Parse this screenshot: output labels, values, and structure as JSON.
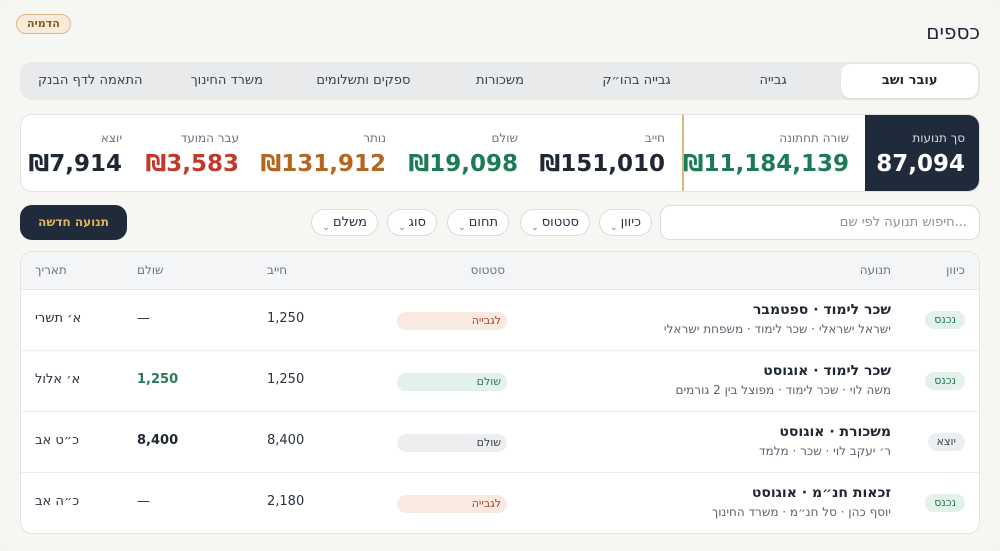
{
  "demo_badge": "הדמיה",
  "page_title": "כספים",
  "tabs": [
    {
      "label": "עובר ושב",
      "active": true
    },
    {
      "label": "גבייה",
      "active": false
    },
    {
      "label": "גבייה בהו״ק",
      "active": false
    },
    {
      "label": "משכורות",
      "active": false
    },
    {
      "label": "ספקים ותשלומים",
      "active": false
    },
    {
      "label": "משרד החינוך",
      "active": false
    },
    {
      "label": "התאמה לדף הבנק",
      "active": false
    }
  ],
  "stats": {
    "total": {
      "label": "סך תנועות",
      "value": "87,094"
    },
    "bottom_line": {
      "label": "שורה תחתונה",
      "value": "₪11,184,139",
      "color": "#1c7a55"
    },
    "owed": {
      "label": "חייב",
      "value": "₪151,010",
      "color": "#1f2733"
    },
    "paid": {
      "label": "שולם",
      "value": "₪19,098",
      "color": "#1c7a55"
    },
    "remaining": {
      "label": "נותר",
      "value": "₪131,912",
      "color": "#b5651d"
    },
    "overdue": {
      "label": "עבר המועד",
      "value": "₪3,583",
      "color": "#c0392b"
    },
    "outgoing": {
      "label": "יוצא",
      "value": "₪7,914",
      "color": "#1f2733"
    }
  },
  "search": {
    "placeholder": "חיפוש תנועה לפי שם..."
  },
  "filters": [
    "כיוון",
    "סטטוס",
    "תחום",
    "סוג",
    "משלם"
  ],
  "new_button": "תנועה חדשה",
  "table": {
    "headers": {
      "direction": "כיוון",
      "movement": "תנועה",
      "status": "סטטוס",
      "owed": "חייב",
      "paid": "שולם",
      "date": "תאריך"
    },
    "rows": [
      {
        "direction": "נכנס",
        "dir_type": "in",
        "title": "שכר לימוד · ספטמבר",
        "subtitle": "ישראל ישראלי · שכר לימוד · משפחת ישראלי",
        "status": "לגבייה",
        "status_type": "collect",
        "owed": "1,250",
        "paid": "—",
        "paid_style": "",
        "date": "א׳ תשרי"
      },
      {
        "direction": "נכנס",
        "dir_type": "in",
        "title": "שכר לימוד · אוגוסט",
        "subtitle": "משה לוי · שכר לימוד · מפוצל בין 2 גורמים",
        "status": "שולם",
        "status_type": "paid",
        "owed": "1,250",
        "paid": "1,250",
        "paid_style": "green",
        "date": "א׳ אלול"
      },
      {
        "direction": "יוצא",
        "dir_type": "out",
        "title": "משכורת · אוגוסט",
        "subtitle": "ר׳ יעקב לוי · שכר · מלמד",
        "status": "שולם",
        "status_type": "paid-gray",
        "owed": "8,400",
        "paid": "8,400",
        "paid_style": "bold",
        "date": "כ״ט אב"
      },
      {
        "direction": "נכנס",
        "dir_type": "in",
        "title": "זכאות חנ״מ · אוגוסט",
        "subtitle": "יוסף כהן · סל חנ״מ · משרד החינוך",
        "status": "לגבייה",
        "status_type": "collect",
        "owed": "2,180",
        "paid": "—",
        "paid_style": "",
        "date": "כ״ה אב"
      }
    ]
  }
}
